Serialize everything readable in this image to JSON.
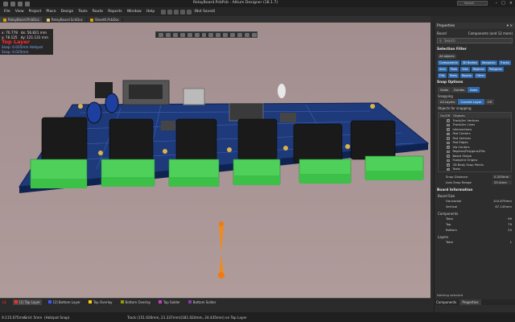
{
  "window": {
    "title": "RelayBoard.PcbPcb - Altium Designer (18.1.7)",
    "search_placeholder": "Search"
  },
  "menu": [
    "File",
    "View",
    "Project",
    "Place",
    "Design",
    "Tools",
    "Route",
    "Reports",
    "Window",
    "Help"
  ],
  "not_saved": "(Not Saved)",
  "doc_tabs": [
    {
      "label": "RelayBoard.PcbDoc",
      "color": "#d9a300",
      "active": true
    },
    {
      "label": "RelayBoard.SchDoc",
      "color": "#e3c96a",
      "active": false
    },
    {
      "label": "Sheet6.PcbDoc",
      "color": "#d9a300",
      "active": false
    }
  ],
  "hud": {
    "x": "x: 70.778",
    "dx": "dx: 56.821 mm",
    "y": "y: 78.125",
    "dy": "dy: 121.131 mm",
    "layer": "Top Layer",
    "snap": "Snap: 0.025mm Hotspot Snap: 0.025mm"
  },
  "layer_tabs": [
    {
      "label": "LS",
      "color": "#ff2b2b"
    },
    {
      "label": "[1] Top Layer",
      "color": "#ff2b2b",
      "active": true
    },
    {
      "label": "[2] Bottom Layer",
      "color": "#3b5bff"
    },
    {
      "label": "Top Overlay",
      "color": "#ffd200"
    },
    {
      "label": "Bottom Overlay",
      "color": "#9a9a00"
    },
    {
      "label": "Top Solder",
      "color": "#c040c0"
    },
    {
      "label": "Bottom Solder",
      "color": "#8040a0"
    }
  ],
  "status": {
    "coords": "X:115.075mm",
    "grid": "Grid: 5mm",
    "snap": "(Hotspot Snap)",
    "center": "Track (151.026mm, 21.337mm)(181.024mm, 24.435mm) on Top Layer"
  },
  "properties": {
    "title": "Properties",
    "board_label": "Board",
    "board_value": "Components (and 12 more)",
    "search": "Search",
    "selection_filter": "Selection Filter",
    "all_objects": "All objects",
    "filter_chips": [
      "Components",
      "3D Bodies",
      "Keepouts",
      "Tracks",
      "Arcs",
      "Pads",
      "Vias",
      "Regions",
      "Polygons",
      "Fills",
      "Texts",
      "Rooms",
      "Other"
    ],
    "snap_options": "Snap Options",
    "grids_label": [
      "Grids",
      "Guides",
      "Axes"
    ],
    "snapping": "Snapping",
    "snapping_opts": [
      "All Layers",
      "Current Layer",
      "Off"
    ],
    "objects_for_snapping": "Objects for snapping",
    "snap_header": [
      "On/Off",
      "Objects"
    ],
    "snap_objects": [
      {
        "label": "Track/Arc Vertices",
        "on": true
      },
      {
        "label": "Track/Arc Lines",
        "on": false
      },
      {
        "label": "Intersections",
        "on": true
      },
      {
        "label": "Pad Centers",
        "on": true
      },
      {
        "label": "Pad Vertices",
        "on": false
      },
      {
        "label": "Pad Edges",
        "on": false
      },
      {
        "label": "Via Centers",
        "on": true
      },
      {
        "label": "Regions/Polygons/Fills",
        "on": false
      },
      {
        "label": "Board Shape",
        "on": false
      },
      {
        "label": "Footprint Origins",
        "on": false
      },
      {
        "label": "3D Body Snap Points",
        "on": true
      },
      {
        "label": "Texts",
        "on": true
      }
    ],
    "snap_distance_label": "Snap Distance",
    "snap_distance": "0.203mm",
    "axis_snap_label": "Axis Snap Range",
    "axis_snap": "25.4mm",
    "board_information": "Board Information",
    "board_size": "Board Size",
    "horizontal_label": "Horizontal",
    "horizontal": "104.879mm",
    "vertical_label": "Vertical",
    "vertical": "67.145mm",
    "components": "Components",
    "total_label": "Total",
    "total": "99",
    "top_label": "Top",
    "top": "79",
    "bottom_label": "Bottom",
    "bottom": "20",
    "layers": "Layers",
    "layers_total_label": "Total",
    "layers_total": "1",
    "nothing_selected": "Nothing selected"
  },
  "bottom_tabs": [
    "Components",
    "Properties"
  ]
}
